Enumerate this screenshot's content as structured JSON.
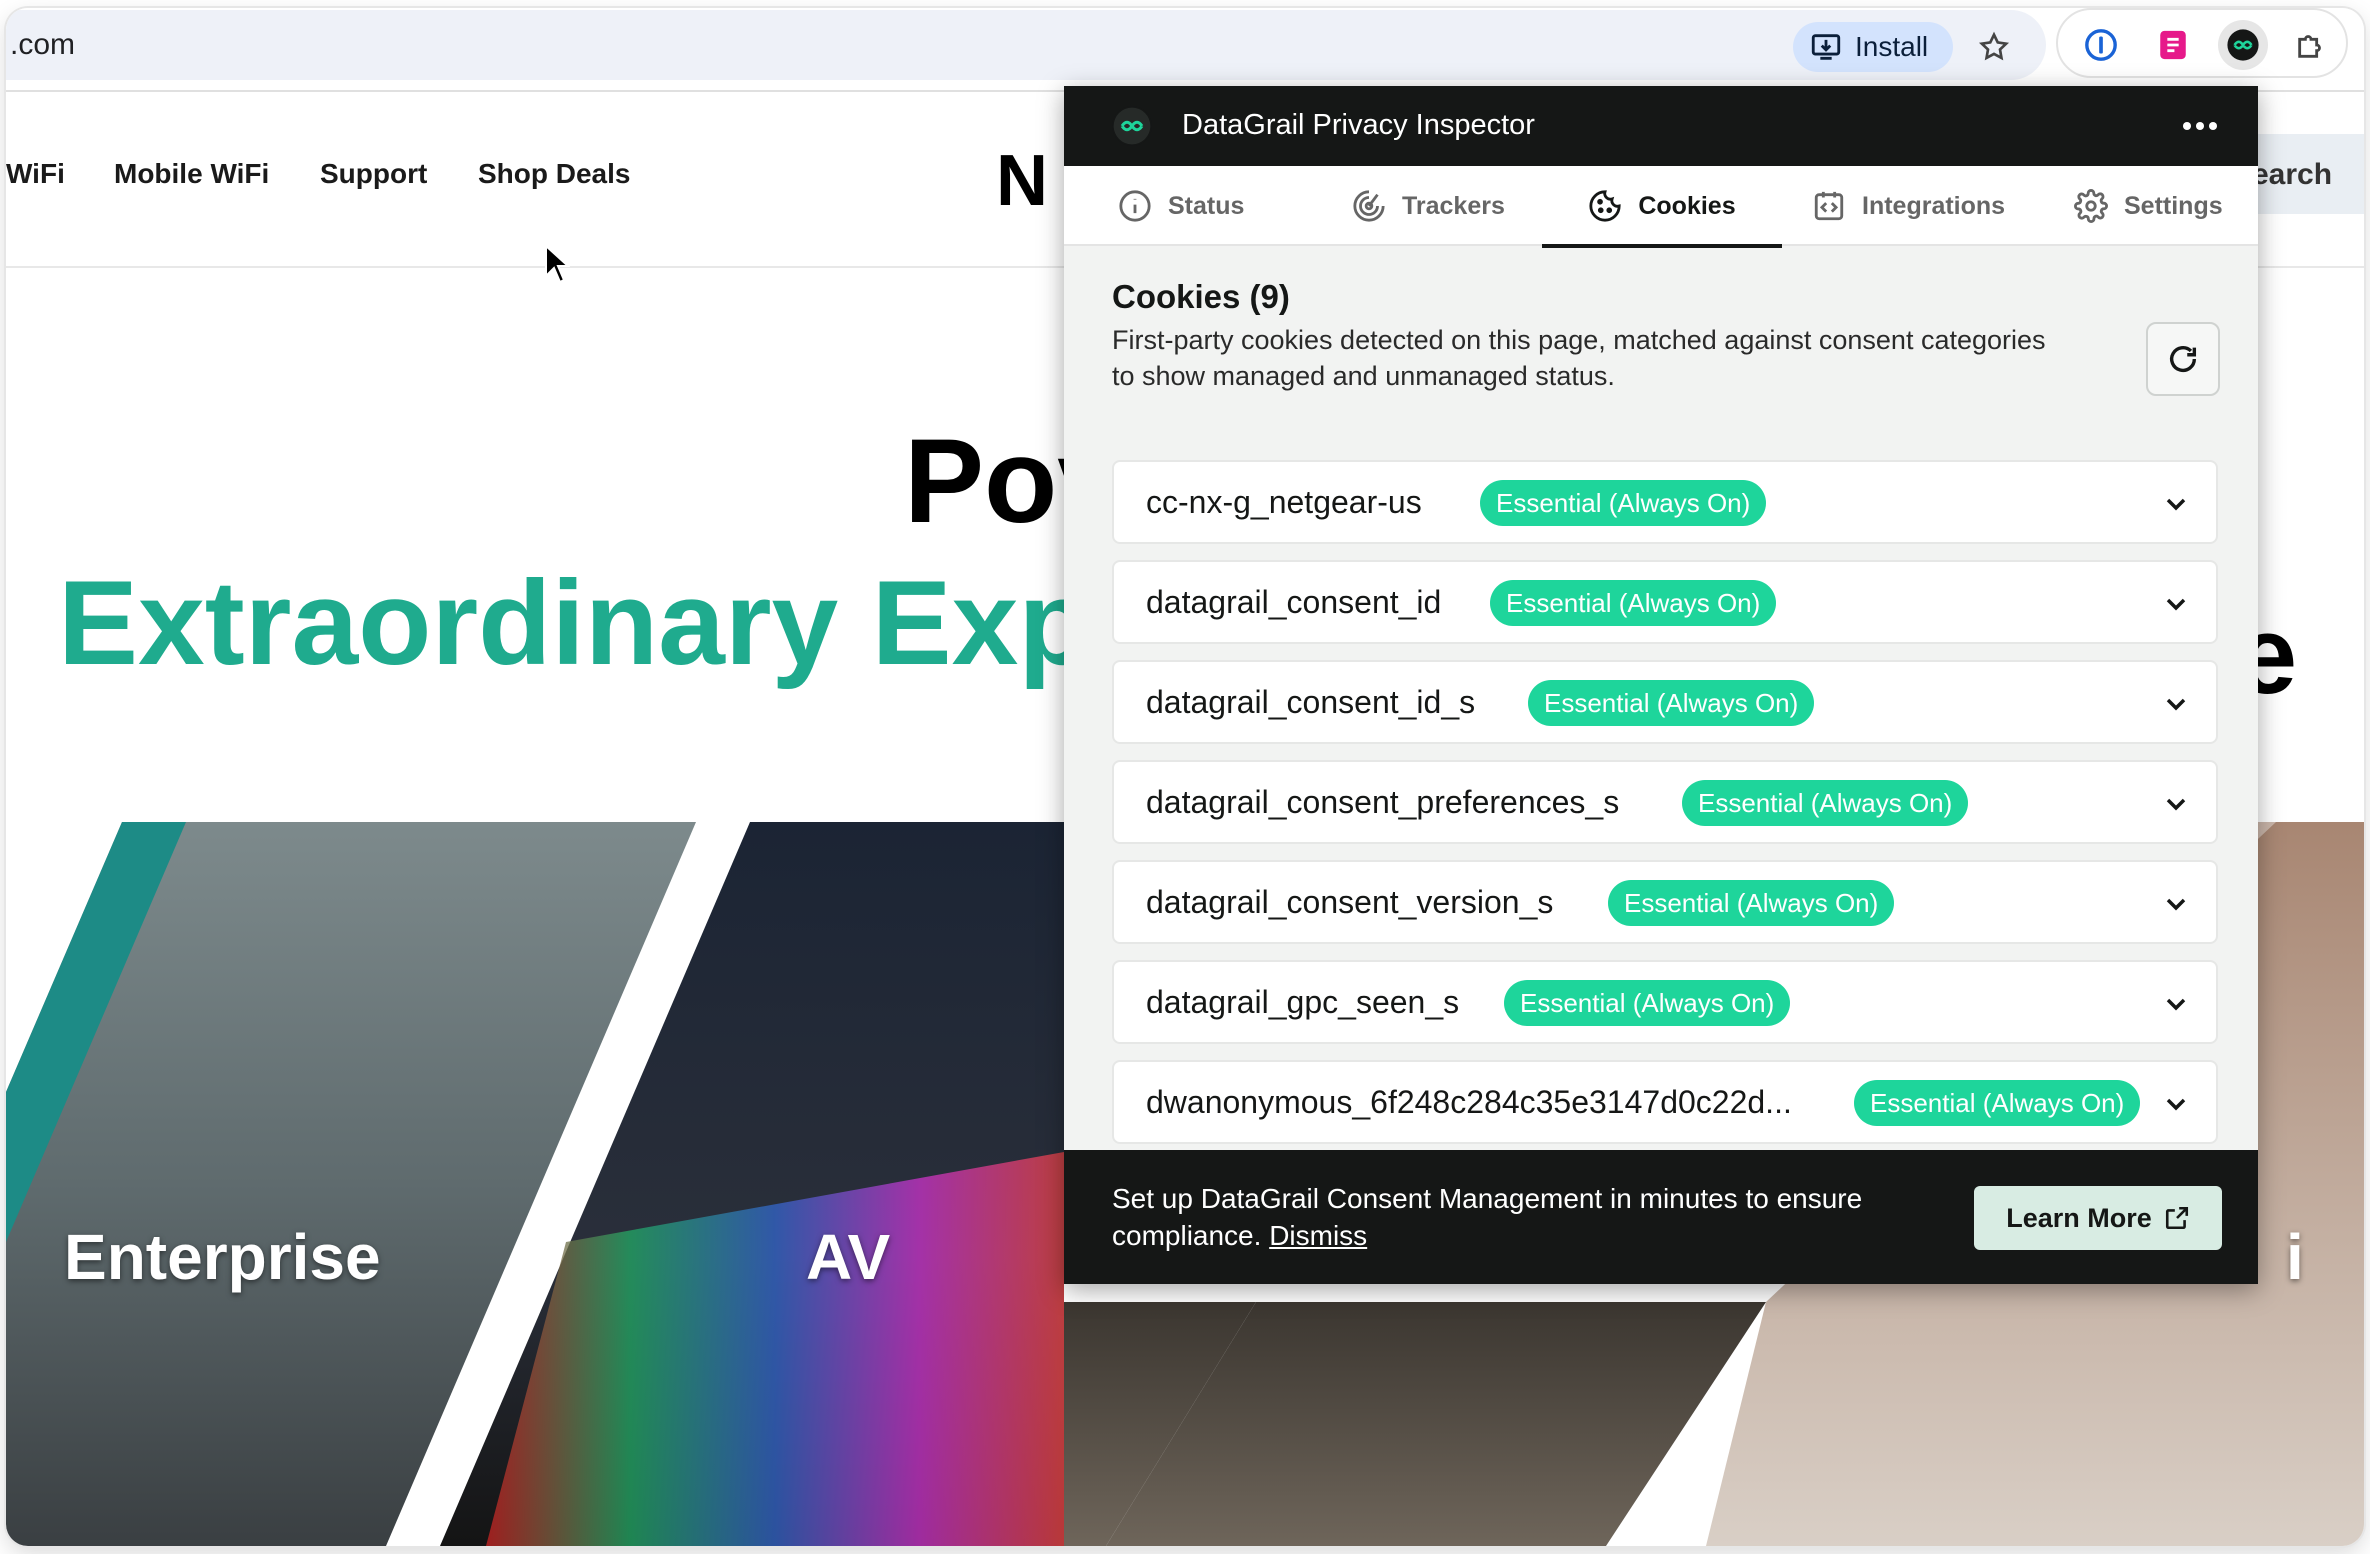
{
  "browser": {
    "url": ".com",
    "install_label": "Install"
  },
  "site": {
    "nav": [
      "WiFi",
      "Mobile WiFi",
      "Support",
      "Shop Deals"
    ],
    "logo_text": "N",
    "search_label": "earch",
    "hero_line1": "Pov",
    "hero_line2": "Extraordinary Exp",
    "hero_trail": "e",
    "tiles": [
      {
        "label": "Enterprise"
      },
      {
        "label": "AV"
      },
      {
        "label": ""
      },
      {
        "label": "i"
      }
    ]
  },
  "popup": {
    "title": "DataGrail Privacy Inspector",
    "tabs": [
      {
        "label": "Status",
        "icon": "info-icon"
      },
      {
        "label": "Trackers",
        "icon": "radar-icon"
      },
      {
        "label": "Cookies",
        "icon": "cookie-icon"
      },
      {
        "label": "Integrations",
        "icon": "integrations-icon"
      },
      {
        "label": "Settings",
        "icon": "gear-icon"
      }
    ],
    "active_tab": "Cookies",
    "section_title": "Cookies (9)",
    "section_desc": "First-party cookies detected on this page, matched against consent categories to show managed and unmanaged status.",
    "cookies": [
      {
        "name": "cc-nx-g_netgear-us",
        "badge": "Essential (Always On)"
      },
      {
        "name": "datagrail_consent_id",
        "badge": "Essential (Always On)"
      },
      {
        "name": "datagrail_consent_id_s",
        "badge": "Essential (Always On)"
      },
      {
        "name": "datagrail_consent_preferences_s",
        "badge": "Essential (Always On)"
      },
      {
        "name": "datagrail_consent_version_s",
        "badge": "Essential (Always On)"
      },
      {
        "name": "datagrail_gpc_seen_s",
        "badge": "Essential (Always On)"
      },
      {
        "name": "dwanonymous_6f248c284c35e3147d0c22d...",
        "badge": "Essential (Always On)"
      }
    ],
    "footer_message": "Set up DataGrail Consent Management in minutes to ensure compliance.",
    "dismiss_label": "Dismiss",
    "learn_more_label": "Learn More"
  },
  "colors": {
    "accent": "#1ed59b",
    "hero_green": "#1fab8e",
    "dark": "#151716"
  }
}
